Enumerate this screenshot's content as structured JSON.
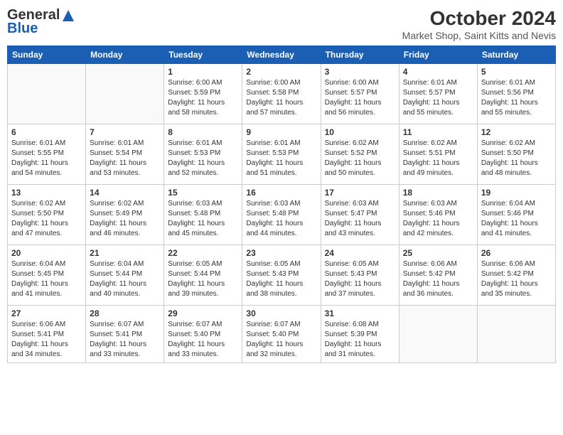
{
  "logo": {
    "general": "General",
    "blue": "Blue"
  },
  "title": "October 2024",
  "subtitle": "Market Shop, Saint Kitts and Nevis",
  "days_of_week": [
    "Sunday",
    "Monday",
    "Tuesday",
    "Wednesday",
    "Thursday",
    "Friday",
    "Saturday"
  ],
  "weeks": [
    [
      {
        "day": "",
        "info": ""
      },
      {
        "day": "",
        "info": ""
      },
      {
        "day": "1",
        "info": "Sunrise: 6:00 AM\nSunset: 5:59 PM\nDaylight: 11 hours and 58 minutes."
      },
      {
        "day": "2",
        "info": "Sunrise: 6:00 AM\nSunset: 5:58 PM\nDaylight: 11 hours and 57 minutes."
      },
      {
        "day": "3",
        "info": "Sunrise: 6:00 AM\nSunset: 5:57 PM\nDaylight: 11 hours and 56 minutes."
      },
      {
        "day": "4",
        "info": "Sunrise: 6:01 AM\nSunset: 5:57 PM\nDaylight: 11 hours and 55 minutes."
      },
      {
        "day": "5",
        "info": "Sunrise: 6:01 AM\nSunset: 5:56 PM\nDaylight: 11 hours and 55 minutes."
      }
    ],
    [
      {
        "day": "6",
        "info": "Sunrise: 6:01 AM\nSunset: 5:55 PM\nDaylight: 11 hours and 54 minutes."
      },
      {
        "day": "7",
        "info": "Sunrise: 6:01 AM\nSunset: 5:54 PM\nDaylight: 11 hours and 53 minutes."
      },
      {
        "day": "8",
        "info": "Sunrise: 6:01 AM\nSunset: 5:53 PM\nDaylight: 11 hours and 52 minutes."
      },
      {
        "day": "9",
        "info": "Sunrise: 6:01 AM\nSunset: 5:53 PM\nDaylight: 11 hours and 51 minutes."
      },
      {
        "day": "10",
        "info": "Sunrise: 6:02 AM\nSunset: 5:52 PM\nDaylight: 11 hours and 50 minutes."
      },
      {
        "day": "11",
        "info": "Sunrise: 6:02 AM\nSunset: 5:51 PM\nDaylight: 11 hours and 49 minutes."
      },
      {
        "day": "12",
        "info": "Sunrise: 6:02 AM\nSunset: 5:50 PM\nDaylight: 11 hours and 48 minutes."
      }
    ],
    [
      {
        "day": "13",
        "info": "Sunrise: 6:02 AM\nSunset: 5:50 PM\nDaylight: 11 hours and 47 minutes."
      },
      {
        "day": "14",
        "info": "Sunrise: 6:02 AM\nSunset: 5:49 PM\nDaylight: 11 hours and 46 minutes."
      },
      {
        "day": "15",
        "info": "Sunrise: 6:03 AM\nSunset: 5:48 PM\nDaylight: 11 hours and 45 minutes."
      },
      {
        "day": "16",
        "info": "Sunrise: 6:03 AM\nSunset: 5:48 PM\nDaylight: 11 hours and 44 minutes."
      },
      {
        "day": "17",
        "info": "Sunrise: 6:03 AM\nSunset: 5:47 PM\nDaylight: 11 hours and 43 minutes."
      },
      {
        "day": "18",
        "info": "Sunrise: 6:03 AM\nSunset: 5:46 PM\nDaylight: 11 hours and 42 minutes."
      },
      {
        "day": "19",
        "info": "Sunrise: 6:04 AM\nSunset: 5:46 PM\nDaylight: 11 hours and 41 minutes."
      }
    ],
    [
      {
        "day": "20",
        "info": "Sunrise: 6:04 AM\nSunset: 5:45 PM\nDaylight: 11 hours and 41 minutes."
      },
      {
        "day": "21",
        "info": "Sunrise: 6:04 AM\nSunset: 5:44 PM\nDaylight: 11 hours and 40 minutes."
      },
      {
        "day": "22",
        "info": "Sunrise: 6:05 AM\nSunset: 5:44 PM\nDaylight: 11 hours and 39 minutes."
      },
      {
        "day": "23",
        "info": "Sunrise: 6:05 AM\nSunset: 5:43 PM\nDaylight: 11 hours and 38 minutes."
      },
      {
        "day": "24",
        "info": "Sunrise: 6:05 AM\nSunset: 5:43 PM\nDaylight: 11 hours and 37 minutes."
      },
      {
        "day": "25",
        "info": "Sunrise: 6:06 AM\nSunset: 5:42 PM\nDaylight: 11 hours and 36 minutes."
      },
      {
        "day": "26",
        "info": "Sunrise: 6:06 AM\nSunset: 5:42 PM\nDaylight: 11 hours and 35 minutes."
      }
    ],
    [
      {
        "day": "27",
        "info": "Sunrise: 6:06 AM\nSunset: 5:41 PM\nDaylight: 11 hours and 34 minutes."
      },
      {
        "day": "28",
        "info": "Sunrise: 6:07 AM\nSunset: 5:41 PM\nDaylight: 11 hours and 33 minutes."
      },
      {
        "day": "29",
        "info": "Sunrise: 6:07 AM\nSunset: 5:40 PM\nDaylight: 11 hours and 33 minutes."
      },
      {
        "day": "30",
        "info": "Sunrise: 6:07 AM\nSunset: 5:40 PM\nDaylight: 11 hours and 32 minutes."
      },
      {
        "day": "31",
        "info": "Sunrise: 6:08 AM\nSunset: 5:39 PM\nDaylight: 11 hours and 31 minutes."
      },
      {
        "day": "",
        "info": ""
      },
      {
        "day": "",
        "info": ""
      }
    ]
  ]
}
